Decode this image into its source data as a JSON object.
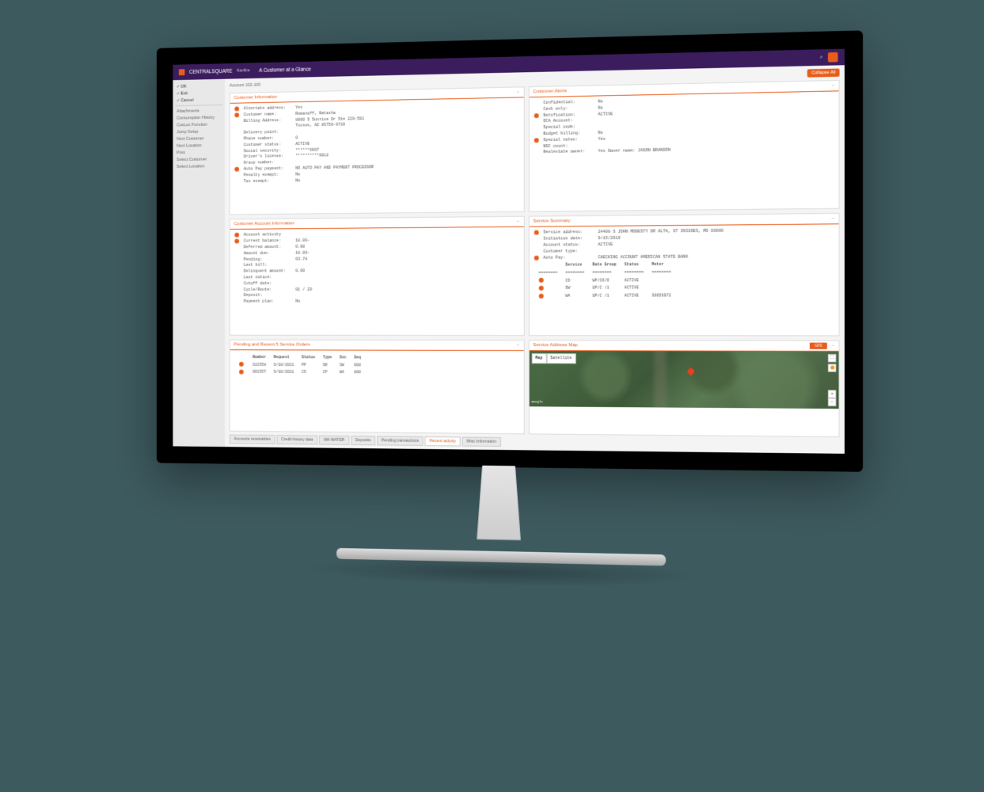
{
  "header": {
    "brand": "CENTRALSQUARE",
    "brand_sub": "Naviline",
    "page_title": "A Customer at a Glance",
    "search_placeholder": "Search"
  },
  "sidebar": {
    "top": [
      {
        "label": "OK"
      },
      {
        "label": "Exit"
      },
      {
        "label": "Cancel"
      }
    ],
    "items": [
      {
        "label": "Attachments"
      },
      {
        "label": "Consumption History"
      },
      {
        "label": "CusLoc Function"
      },
      {
        "label": "Jump Setup"
      },
      {
        "label": "Next Customer"
      },
      {
        "label": "Next Location"
      },
      {
        "label": "Print"
      },
      {
        "label": "Select Customer"
      },
      {
        "label": "Select Location"
      }
    ]
  },
  "page_head": {
    "account_label": "Account 102-100",
    "collapse": "Collapse All"
  },
  "panels": {
    "customer_info": {
      "title": "Customer Information",
      "rows": [
        {
          "bullet": true,
          "label": "Alternate address:",
          "value": "Yes"
        },
        {
          "bullet": true,
          "label": "Customer name:",
          "value": "Romanoff, Natasha"
        },
        {
          "bullet": false,
          "label": "Billing Address:",
          "value": "8000 S Sunrise Dr Ste 220-591"
        },
        {
          "bullet": false,
          "label": "",
          "value": "Tucson, AZ  85750-0719"
        },
        {
          "bullet": false,
          "label": "Delivery point:",
          "value": ""
        },
        {
          "bullet": false,
          "label": "Phone number:",
          "value": "0"
        },
        {
          "bullet": false,
          "label": "Customer status:",
          "value": "ACTIVE"
        },
        {
          "bullet": false,
          "label": "Social security:",
          "value": "******6607"
        },
        {
          "bullet": false,
          "label": "Driver's license:",
          "value": "**********0012"
        },
        {
          "bullet": false,
          "label": "Group number:",
          "value": ""
        },
        {
          "bullet": true,
          "label": "Auto Pay payment:",
          "value": "NO AUTO PAY AND PAYMENT PROCESSOR"
        },
        {
          "bullet": false,
          "label": "Penalty exempt:",
          "value": "No"
        },
        {
          "bullet": false,
          "label": "Tax exempt:",
          "value": "No"
        }
      ]
    },
    "customer_alerts": {
      "title": "Customer Alerts",
      "rows": [
        {
          "bullet": false,
          "label": "Confidential:",
          "value": "No"
        },
        {
          "bullet": false,
          "label": "Cash only:",
          "value": "No"
        },
        {
          "bullet": true,
          "label": "Notification:",
          "value": "ACTIVE"
        },
        {
          "bullet": false,
          "label": "OCA Account:",
          "value": ""
        },
        {
          "bullet": false,
          "label": "Special code:",
          "value": ""
        },
        {
          "bullet": false,
          "label": "Budget billing:",
          "value": "No"
        },
        {
          "bullet": true,
          "label": "Special notes:",
          "value": "Yes"
        },
        {
          "bullet": false,
          "label": "NSF count:",
          "value": ""
        },
        {
          "bullet": false,
          "label": "Realestate owner:",
          "value": "Yes     Owner name: JASON BRANDON"
        }
      ]
    },
    "account_info": {
      "title": "Customer Account Information",
      "rows": [
        {
          "bullet": true,
          "label": "Account activity",
          "value": ""
        },
        {
          "bullet": true,
          "label": "Current balance:",
          "value": "18.00-"
        },
        {
          "bullet": false,
          "label": "Deferred amount:",
          "value": "0.00"
        },
        {
          "bullet": false,
          "label": "Amount due:",
          "value": "18.00-"
        },
        {
          "bullet": false,
          "label": "Pending:",
          "value": "63.78"
        },
        {
          "bullet": false,
          "label": "Last bill:",
          "value": ""
        },
        {
          "bullet": false,
          "label": "Delinquent amount:",
          "value": "0.00"
        },
        {
          "bullet": false,
          "label": "Last notice:",
          "value": ""
        },
        {
          "bullet": false,
          "label": "Cutoff date:",
          "value": ""
        },
        {
          "bullet": false,
          "label": "Cycle/Route:",
          "value": "01 / 29"
        },
        {
          "bullet": false,
          "label": "Deposit:",
          "value": ""
        },
        {
          "bullet": false,
          "label": "Payment plan:",
          "value": "No"
        }
      ]
    },
    "service_summary": {
      "title": "Service Summary",
      "rows": [
        {
          "bullet": true,
          "label": "Service address:",
          "value": "24408 S JOHN MODESTY DR          ALTA,  ST INIGOES, MD  00000"
        },
        {
          "bullet": false,
          "label": "Initiation date:",
          "value": "9/15/2010"
        },
        {
          "bullet": false,
          "label": "Account status:",
          "value": "ACTIVE"
        },
        {
          "bullet": false,
          "label": "Customer type:",
          "value": ""
        },
        {
          "bullet": true,
          "label": "Auto Pay:",
          "value": "CHECKING ACCOUNT AMERICAN STATE BANK"
        }
      ],
      "service_table": {
        "headers": [
          "",
          "Service",
          "Rate Group",
          "Status",
          "Meter"
        ],
        "divider": "========",
        "rows": [
          {
            "bullet": true,
            "c1": "CO",
            "c2": "WP/CO/O",
            "c3": "ACTIVE",
            "c4": ""
          },
          {
            "bullet": true,
            "c1": "SW",
            "c2": "UP/C /1",
            "c3": "ACTIVE",
            "c4": ""
          },
          {
            "bullet": true,
            "c1": "WA",
            "c2": "UP/C /1",
            "c3": "ACTIVE",
            "c4": "30056972"
          }
        ]
      }
    },
    "service_orders": {
      "title": "Pending and Recent 5 Service Orders",
      "table": {
        "headers": [
          "Number",
          "Request",
          "Status",
          "Type",
          "Svc",
          "Seq"
        ],
        "rows": [
          {
            "bullet": true,
            "c0": "022358",
            "c1": "9/10/2021",
            "c2": "PP",
            "c3": "SR",
            "c4": "SW",
            "c5": "000"
          },
          {
            "bullet": true,
            "c0": "002357",
            "c1": "9/10/2021",
            "c2": "CO",
            "c3": "CP",
            "c4": "WA",
            "c5": "000"
          }
        ]
      }
    },
    "map": {
      "title": "Service Address Map",
      "gis_label": "GIS",
      "tabs": {
        "map": "Map",
        "satellite": "Satellite"
      },
      "google": "Google"
    }
  },
  "bottom_tabs": [
    {
      "label": "Accounts receivables",
      "active": false
    },
    {
      "label": "Credit history data",
      "active": false
    },
    {
      "label": "WA WATER",
      "active": false
    },
    {
      "label": "Deposits",
      "active": false
    },
    {
      "label": "Pending transactions",
      "active": false
    },
    {
      "label": "Recent activity",
      "active": true
    },
    {
      "label": "Misc Information",
      "active": false
    }
  ]
}
